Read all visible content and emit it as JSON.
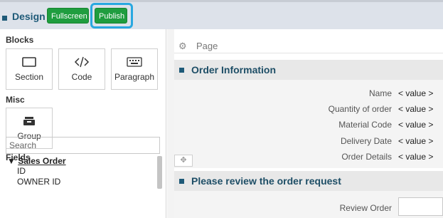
{
  "topbar": {
    "title": "Design",
    "fullscreen_label": "Fullscreen",
    "publish_label": "Publish"
  },
  "left": {
    "blocks_label": "Blocks",
    "blocks": [
      {
        "label": "Section",
        "icon": "section-icon"
      },
      {
        "label": "Code",
        "icon": "code-icon"
      },
      {
        "label": "Paragraph",
        "icon": "keyboard-icon"
      }
    ],
    "misc_label": "Misc",
    "misc": [
      {
        "label": "Group",
        "icon": "inbox-icon"
      }
    ],
    "fields_label": "Fields",
    "search_placeholder": "Search",
    "tree": {
      "root": "Sales Order",
      "root_toggle": "▼",
      "children": [
        "ID",
        "OWNER ID"
      ]
    }
  },
  "right": {
    "page_label": "Page",
    "section1": {
      "title": "Order Information",
      "fields": [
        {
          "label": "Name",
          "value": "< value >"
        },
        {
          "label": "Quantity of order",
          "value": "< value >"
        },
        {
          "label": "Material Code",
          "value": "< value >"
        },
        {
          "label": "Delivery Date",
          "value": "< value >"
        },
        {
          "label": "Order Details",
          "value": "< value >"
        }
      ]
    },
    "section2": {
      "title": "Please review the order request",
      "field_label": "Review Order"
    }
  },
  "colors": {
    "accent": "#1e5a78",
    "button_green": "#1f9d3f",
    "highlight": "#29a8e0"
  }
}
